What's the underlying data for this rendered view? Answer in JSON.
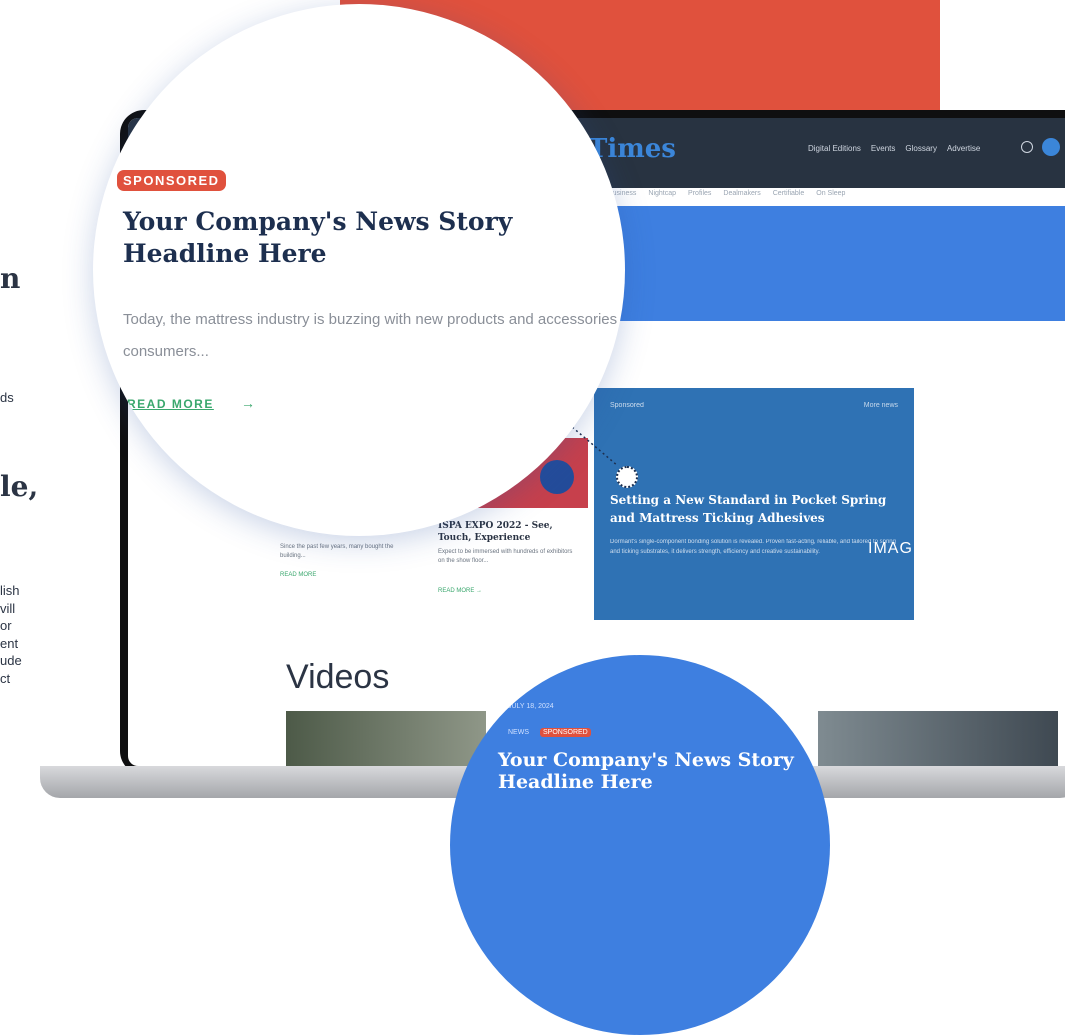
{
  "colors": {
    "brand_red": "#e0513d",
    "site_blue": "#3e7fe0",
    "featured_blue": "#2f72b4",
    "header_dark": "#283341",
    "link_green": "#3aa76d",
    "headline_navy": "#1d2f4f"
  },
  "left_copy": {
    "heading_fragment": "n",
    "text_fragment": "ds",
    "heading2_fragment": "le,",
    "lines": [
      "lish",
      "vill",
      "or",
      "ent",
      "ude",
      "ct"
    ]
  },
  "site": {
    "brand": "Times",
    "topnav": [
      "Digital Editions",
      "Events",
      "Glossary",
      "Advertise"
    ],
    "subnav": [
      "Business",
      "Nightcap",
      "Profiles",
      "Dealmakers",
      "Certifiable",
      "On Sleep"
    ],
    "featured": {
      "tag": "Sponsored",
      "more": "More news",
      "title": "Setting a New Standard in Pocket Spring and Mattress Ticking Adhesives",
      "description": "Dormant's single-component bonding solution is revealed. Proven fast-acting, reliable, and tailored to spring and ticking substrates, it delivers strength, efficiency and creative sustainability."
    },
    "image_label": "IMAG",
    "cards": [
      {
        "title": "",
        "desc": "Since the past few years, many bought the building...",
        "link": "READ MORE"
      },
      {
        "title": "ISPA EXPO 2022 - See, Touch, Experience",
        "desc": "Expect to be immersed with hundreds of exhibitors on the show floor...",
        "link": "READ MORE →"
      }
    ],
    "videos_title": "Videos"
  },
  "magnifier": {
    "badge": "SPONSORED",
    "headline": "Your Company's News Story Headline Here",
    "body": "Today, the mattress industry is buzzing with new products and accessories for consumers...",
    "read_more": "READ MORE",
    "arrow": "→"
  },
  "bottom_circle": {
    "date": "JULY 18, 2024",
    "news_label": "NEWS",
    "sponsored_label": "SPONSORED",
    "headline": "Your Company's News Story Headline Here"
  }
}
